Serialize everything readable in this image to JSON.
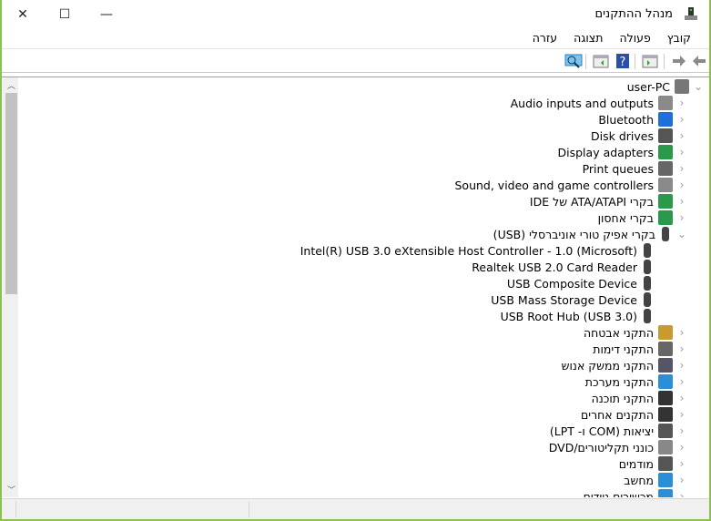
{
  "window": {
    "title": "מנהל ההתקנים",
    "minimize": "—",
    "maximize": "☐",
    "close": "✕"
  },
  "menu": [
    "קובץ",
    "פעולה",
    "תצוגה",
    "עזרה"
  ],
  "toolbar": [
    {
      "name": "back-icon"
    },
    {
      "name": "forward-icon"
    },
    {
      "name": "properties-icon"
    },
    {
      "name": "help-icon"
    },
    {
      "name": "update-driver-icon"
    },
    {
      "name": "scan-hardware-icon"
    }
  ],
  "tree": [
    {
      "label": "user-PC",
      "level": 0,
      "expanded": true,
      "icon": "computer-icon",
      "color": "#777"
    },
    {
      "label": "Audio inputs and outputs",
      "level": 1,
      "icon": "speaker-icon",
      "color": "#8a8a8a"
    },
    {
      "label": "Bluetooth",
      "level": 1,
      "icon": "bluetooth-icon",
      "color": "#1e6fd9"
    },
    {
      "label": "Disk drives",
      "level": 1,
      "icon": "disk-drive-icon",
      "color": "#555"
    },
    {
      "label": "Display adapters",
      "level": 1,
      "icon": "display-adapter-icon",
      "color": "#2a9a4a"
    },
    {
      "label": "Print queues",
      "level": 1,
      "icon": "printer-icon",
      "color": "#666"
    },
    {
      "label": "Sound, video and game controllers",
      "level": 1,
      "icon": "speaker-icon",
      "color": "#8a8a8a"
    },
    {
      "label": "בקרי ATA/ATAPI של IDE",
      "level": 1,
      "icon": "ide-controller-icon",
      "color": "#2a9a4a"
    },
    {
      "label": "בקרי אחסון",
      "level": 1,
      "icon": "storage-controller-icon",
      "color": "#2a9a4a"
    },
    {
      "label": "בקרי אפיק טורי אוניברסלי (USB)",
      "level": 1,
      "expanded": true,
      "icon": "usb-icon",
      "color": "#444"
    },
    {
      "label": "Intel(R) USB 3.0 eXtensible Host Controller - 1.0 (Microsoft)",
      "level": 2,
      "icon": "usb-icon",
      "color": "#444"
    },
    {
      "label": "Realtek USB 2.0 Card Reader",
      "level": 2,
      "icon": "usb-icon",
      "color": "#444"
    },
    {
      "label": "USB Composite Device",
      "level": 2,
      "icon": "usb-icon",
      "color": "#444"
    },
    {
      "label": "USB Mass Storage Device",
      "level": 2,
      "icon": "usb-warning-icon",
      "color": "#444"
    },
    {
      "label": "USB Root Hub (USB 3.0)",
      "level": 2,
      "icon": "usb-icon",
      "color": "#444"
    },
    {
      "label": "התקני אבטחה",
      "level": 1,
      "icon": "security-device-icon",
      "color": "#c99a2e"
    },
    {
      "label": "התקני דימות",
      "level": 1,
      "icon": "imaging-device-icon",
      "color": "#666"
    },
    {
      "label": "התקני ממשק אנוש",
      "level": 1,
      "icon": "hid-icon",
      "color": "#556"
    },
    {
      "label": "התקני מערכת",
      "level": 1,
      "icon": "system-device-icon",
      "color": "#2b8fd8"
    },
    {
      "label": "התקני תוכנה",
      "level": 1,
      "icon": "software-device-icon",
      "color": "#333"
    },
    {
      "label": "התקנים אחרים",
      "level": 1,
      "icon": "unknown-device-icon",
      "color": "#333"
    },
    {
      "label": "יציאות (COM ו- LPT)",
      "level": 1,
      "icon": "port-icon",
      "color": "#555"
    },
    {
      "label": "כונני תקליטורים/DVD",
      "level": 1,
      "icon": "dvd-drive-icon",
      "color": "#888"
    },
    {
      "label": "מודמים",
      "level": 1,
      "icon": "modem-icon",
      "color": "#555"
    },
    {
      "label": "מחשב",
      "level": 1,
      "icon": "monitor-icon",
      "color": "#2b8fd8"
    },
    {
      "label": "מכשירים ניידים",
      "level": 1,
      "icon": "portable-device-icon",
      "color": "#2b8fd8"
    }
  ]
}
